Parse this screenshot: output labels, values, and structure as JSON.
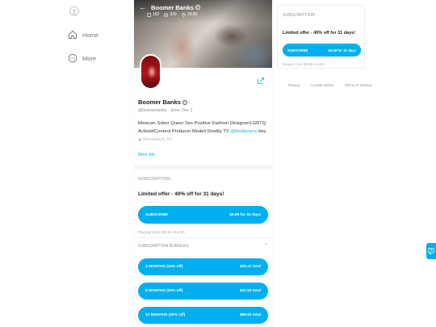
{
  "nav": {
    "items": [
      {
        "label": "Home",
        "icon": "home-icon"
      },
      {
        "label": "More",
        "icon": "more-circle-icon"
      }
    ]
  },
  "profile": {
    "name": "Boomer Banks",
    "stats": {
      "posts": "182",
      "media": "339",
      "likes": "18.8K"
    },
    "handle": "@boomerbanks",
    "seen": "Seen: Dec 2",
    "bio_text": "Mexican Sober Queer Sex Positive Fashion Designer/LGBTQ Activist/Content Producer Model/ Reality TV",
    "bio_link": "@flexbynyco",
    "bio_tail": "boy",
    "location": "Wonderland, NY",
    "more_info": "More info"
  },
  "subscription": {
    "label": "SUBSCRIPTION",
    "offer": "Limited offer - 40% off for 31 days!",
    "button_label": "SUBSCRIBE",
    "button_price": "$5.99 for 31 days",
    "regular_price": "Regular price $9.99 /month"
  },
  "bundles": {
    "label": "SUBSCRIPTION BUNDLES",
    "items": [
      {
        "label": "3 MONTHS (15% off)",
        "price": "$25.47 total"
      },
      {
        "label": "6 MONTHS (20% off)",
        "price": "$47.93 total"
      },
      {
        "label": "12 MONTHS (25% off)",
        "price": "$89.91 total"
      }
    ]
  },
  "right_subscription": {
    "label": "SUBSCRIPTION",
    "offer": "Limited offer - 40% off for 31 days!",
    "button_label": "SUBSCRIBE",
    "button_price": "$5.99 for 31 days",
    "regular_price": "Regular price $9.99 /month"
  },
  "footer": {
    "privacy": "Privacy",
    "cookie": "Cookie Notice",
    "terms": "Terms of Service",
    "separator": "·"
  },
  "colors": {
    "accent": "#00aff0",
    "background": "#ffffff",
    "muted": "#8a8d91"
  }
}
